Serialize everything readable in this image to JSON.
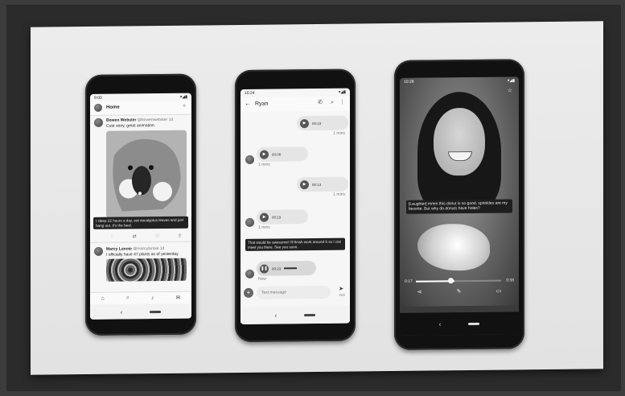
{
  "phone1": {
    "status_time": "9:00",
    "header_title": "Home",
    "tweet1": {
      "author": "Bowen Webster",
      "handle": "@bowenwebster",
      "age": "1d",
      "text": "Cute story, great animation."
    },
    "caption": "I sleep 22 hours a day, eat eucalyptus leaves and just hang out. It's the best.",
    "tweet2": {
      "author": "Marcy Lanoie",
      "handle": "@marcylanoie",
      "age": "1d",
      "text": "I officially have 47 plants as of yesterday"
    }
  },
  "phone2": {
    "status_time": "10:24",
    "contact_name": "Ryan",
    "messages": [
      {
        "duration": "00:23",
        "meta": "1 mins"
      },
      {
        "duration": "00:08",
        "meta": "1 mins"
      },
      {
        "duration": "00:13",
        "meta": "1 mins"
      },
      {
        "duration": "00:19",
        "meta": "1 mins"
      },
      {
        "duration": "00:23",
        "meta": "Now"
      }
    ],
    "caption": "That would be awesome! I'll finish work around 6 so I can meet you there. See you soon.",
    "input_placeholder": "Text message",
    "send_label": "SMS"
  },
  "phone3": {
    "status_time": "10:28",
    "caption": "[Laughter] mmm this donut is so good, sprinkles are my favorite. But why do donuts have holes?",
    "elapsed": "0:17",
    "remaining": "0:38"
  }
}
